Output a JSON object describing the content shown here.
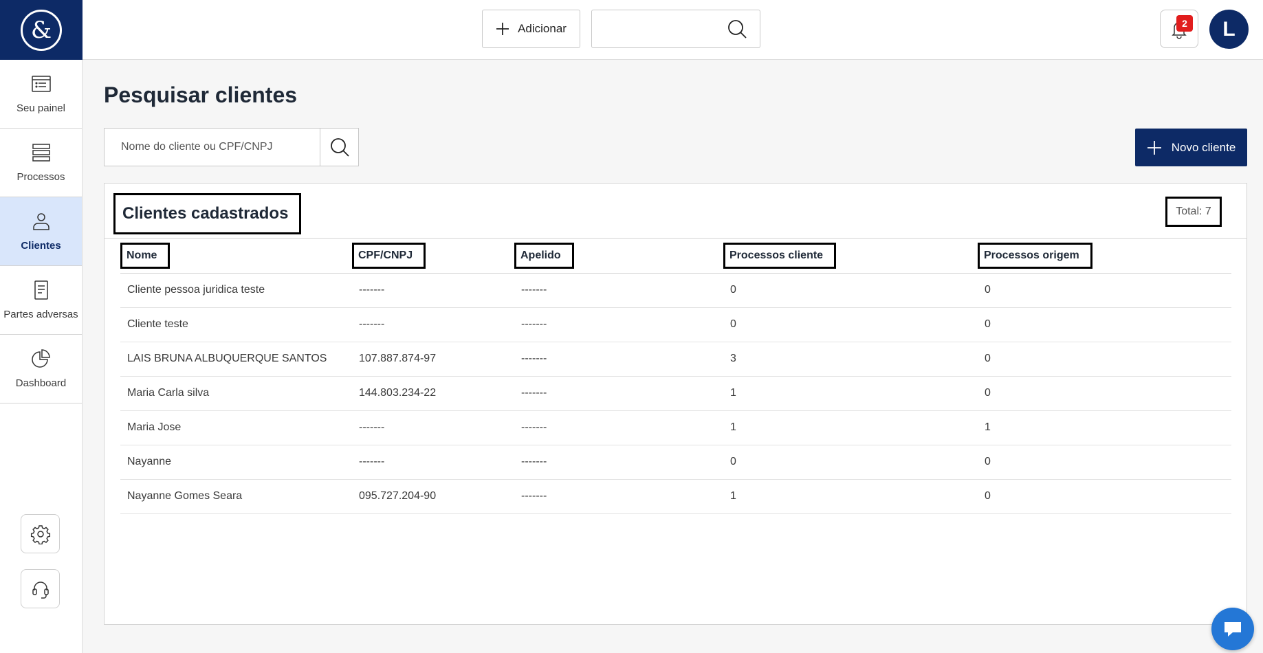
{
  "sidebar": {
    "items": [
      {
        "label": "Seu painel",
        "icon": "dashboard-list-icon"
      },
      {
        "label": "Processos",
        "icon": "stack-icon"
      },
      {
        "label": "Clientes",
        "icon": "person-icon",
        "active": true
      },
      {
        "label": "Partes adversas",
        "icon": "document-icon"
      },
      {
        "label": "Dashboard",
        "icon": "pie-chart-icon"
      }
    ]
  },
  "topbar": {
    "add_label": "Adicionar",
    "search_placeholder": "",
    "notification_count": "2",
    "avatar_initial": "L"
  },
  "main": {
    "title": "Pesquisar clientes",
    "search_placeholder": "Nome do cliente ou CPF/CNPJ",
    "new_client_label": "Novo cliente",
    "card_title": "Clientes cadastrados",
    "total": "Total: 7",
    "columns": [
      "Nome",
      "CPF/CNPJ",
      "Apelido",
      "Processos cliente",
      "Processos origem"
    ],
    "rows": [
      [
        "Cliente pessoa juridica teste",
        "-------",
        "-------",
        "0",
        "0"
      ],
      [
        "Cliente teste",
        "-------",
        "-------",
        "0",
        "0"
      ],
      [
        "LAIS BRUNA ALBUQUERQUE SANTOS",
        "107.887.874-97",
        "-------",
        "3",
        "0"
      ],
      [
        "Maria Carla silva",
        "144.803.234-22",
        "-------",
        "1",
        "0"
      ],
      [
        "Maria Jose",
        "-------",
        "-------",
        "1",
        "1"
      ],
      [
        "Nayanne",
        "-------",
        "-------",
        "0",
        "0"
      ],
      [
        "Nayanne Gomes Seara",
        "095.727.204-90",
        "-------",
        "1",
        "0"
      ]
    ]
  },
  "colors": {
    "brand": "#0d2a66",
    "active_nav_bg": "#d9e6fb",
    "badge": "#e11d1d",
    "chat": "#2477d6"
  }
}
